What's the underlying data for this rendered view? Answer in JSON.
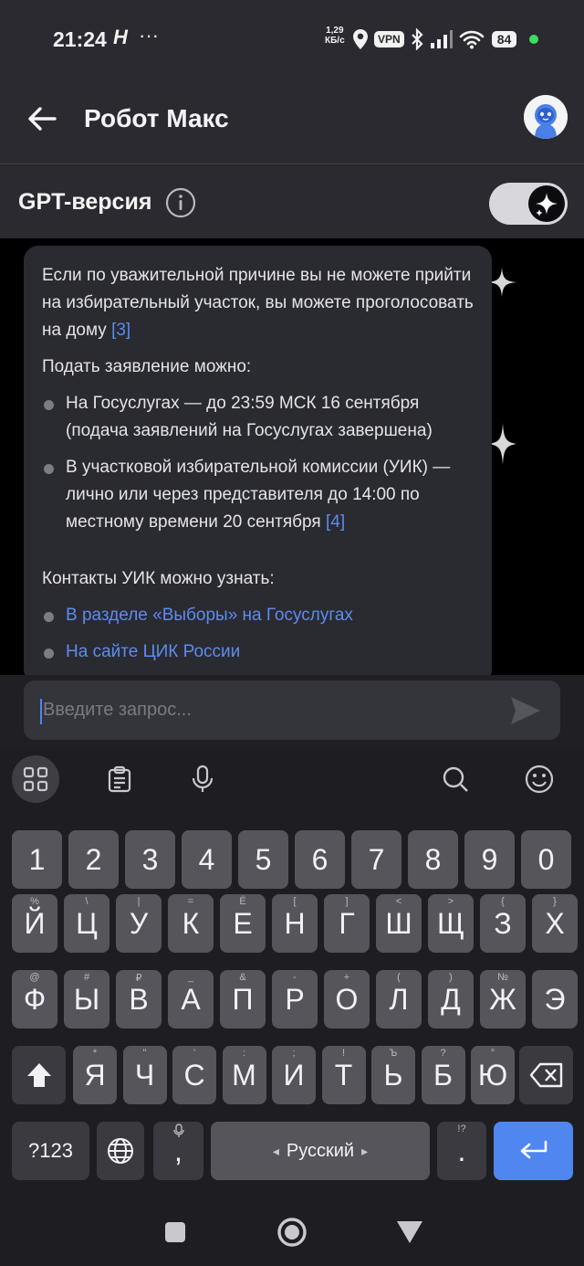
{
  "status_bar": {
    "time": "21:24",
    "h_icon": "H",
    "dots": "···",
    "speed_value": "1,29",
    "speed_unit": "КБ/с",
    "vpn": "VPN",
    "battery": "84"
  },
  "header": {
    "title": "Робот Макс"
  },
  "gpt_toggle": {
    "label": "GPT-версия",
    "on": true
  },
  "message": {
    "intro": "Если по уважительной причине вы не можете прийти на избирательный участок, вы можете проголосовать на дому",
    "intro_cite": "[3]",
    "apply_heading": "Подать заявление можно:",
    "apply_items": [
      {
        "text": "На Госуслугах — до 23:59 МСК 16 сентября (подача заявлений на Госуслугах завершена)",
        "cite": ""
      },
      {
        "text": "В участковой избирательной комиссии (УИК) — лично или через представителя до 14:00 по местному времени 20 сентября",
        "cite": "[4]"
      }
    ],
    "contacts_heading": "Контакты УИК можно узнать:",
    "contact_links": [
      "В разделе «Выборы» на Госуслугах",
      "На сайте ЦИК России"
    ]
  },
  "composer": {
    "placeholder": "Введите запрос..."
  },
  "keyboard": {
    "row_numbers": [
      "1",
      "2",
      "3",
      "4",
      "5",
      "6",
      "7",
      "8",
      "9",
      "0"
    ],
    "row1": [
      {
        "k": "Й",
        "h": "%"
      },
      {
        "k": "Ц",
        "h": "\\"
      },
      {
        "k": "У",
        "h": "|"
      },
      {
        "k": "К",
        "h": "="
      },
      {
        "k": "Е",
        "h": "Ё"
      },
      {
        "k": "Н",
        "h": "["
      },
      {
        "k": "Г",
        "h": "]"
      },
      {
        "k": "Ш",
        "h": "<"
      },
      {
        "k": "Щ",
        "h": ">"
      },
      {
        "k": "З",
        "h": "{"
      },
      {
        "k": "Х",
        "h": "}"
      }
    ],
    "row2": [
      {
        "k": "Ф",
        "h": "@"
      },
      {
        "k": "Ы",
        "h": "#"
      },
      {
        "k": "В",
        "h": "₽"
      },
      {
        "k": "А",
        "h": "_"
      },
      {
        "k": "П",
        "h": "&"
      },
      {
        "k": "Р",
        "h": "-"
      },
      {
        "k": "О",
        "h": "+"
      },
      {
        "k": "Л",
        "h": "("
      },
      {
        "k": "Д",
        "h": ")"
      },
      {
        "k": "Ж",
        "h": "№"
      },
      {
        "k": "Э",
        "h": ""
      }
    ],
    "row3": [
      {
        "k": "Я",
        "h": "*"
      },
      {
        "k": "Ч",
        "h": "\""
      },
      {
        "k": "С",
        "h": "'"
      },
      {
        "k": "М",
        "h": ":"
      },
      {
        "k": "И",
        "h": ";"
      },
      {
        "k": "Т",
        "h": "!"
      },
      {
        "k": "Ь",
        "h": "Ъ"
      },
      {
        "k": "Б",
        "h": "?"
      },
      {
        "k": "Ю",
        "h": "°"
      }
    ],
    "symbols_key": "?123",
    "comma": ",",
    "space_label": "Русский",
    "period": ".",
    "period_hint": "!?",
    "accent_color": "#4f86f0"
  }
}
